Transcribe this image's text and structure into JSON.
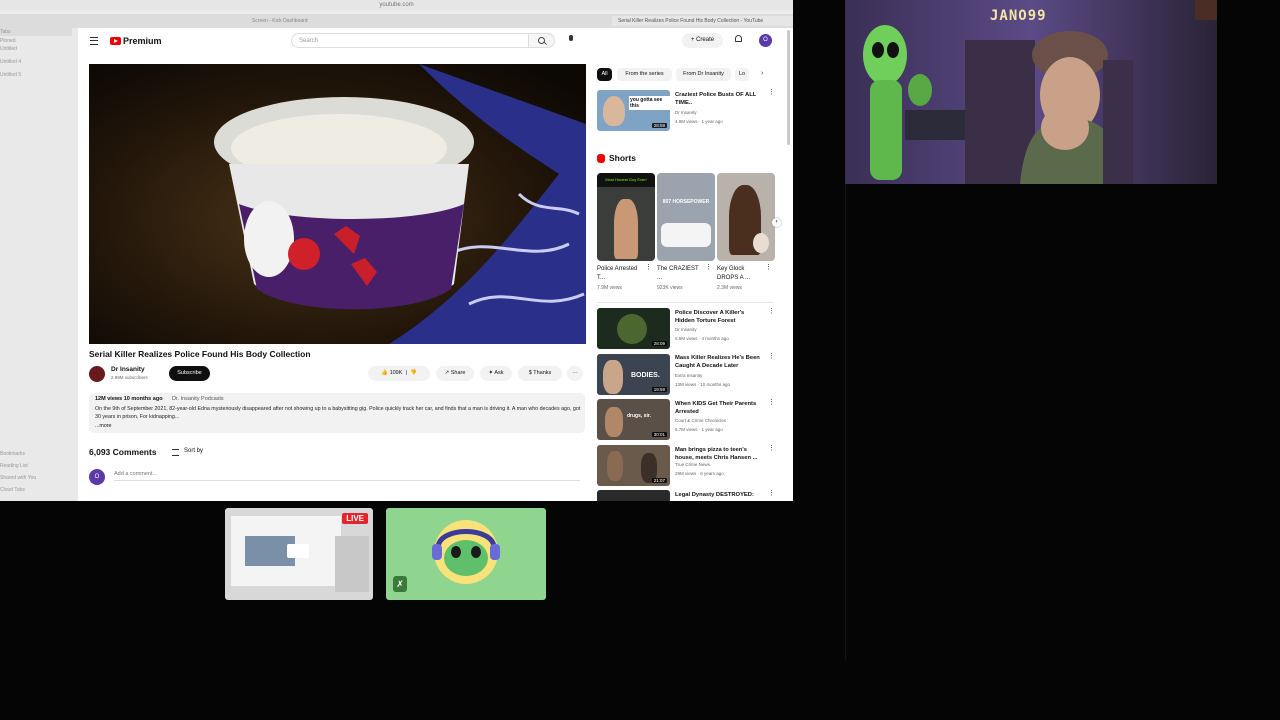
{
  "browser": {
    "url": "youtube.com",
    "tabs": [
      "Screen - Kick Dashboard",
      "Serial Killer Realizes Police Found His Body Collection - YouTube"
    ],
    "sidebar_items": [
      "Tabs",
      "Pinned",
      "Untitled",
      "Untitled 4",
      "Untitled 5",
      "Bookmarks",
      "Reading List",
      "Shared with You",
      "Cloud Tabs"
    ]
  },
  "header": {
    "logo": "Premium",
    "search_placeholder": "Search",
    "create_label": "Create",
    "avatar_letter": "O"
  },
  "video": {
    "title": "Serial Killer Realizes Police Found His Body Collection",
    "channel": "Dr Insanity",
    "subscribers": "2.99M subscribers",
    "subscribe_label": "Subscribe",
    "likes": "109K",
    "share_label": "Share",
    "ask_label": "Ask",
    "thanks_label": "Thanks",
    "description_meta": "12M views  10 months ago",
    "description_tag": "Dr. Insanity Podcasts",
    "description": "On the 9th of September 2021, 82-year-old Edna mysteriously disappeared after not showing up to a babysitting gig. Police quickly track her car, and finds that a man is driving it. A man who decades ago, got 30 years in prison, For kidnapping...",
    "more_label": "...more",
    "comments_count": "6,093 Comments",
    "sort_label": "Sort by",
    "add_comment_placeholder": "Add a comment..."
  },
  "chips": [
    "All",
    "From the series",
    "From Dr Insanity",
    "Lo"
  ],
  "recommended_top": {
    "title": "Craziest Police Busts OF ALL TIME..",
    "channel": "Dr Insanity",
    "meta": "4.9M views · 1 year ago",
    "duration": "28:59",
    "thumb_text": "you gotta see this"
  },
  "shorts": {
    "label": "Shorts",
    "items": [
      {
        "title": "Police Arrested T...",
        "views": "7.9M views",
        "thumb_text": "Most Honest Guy Ever!"
      },
      {
        "title": "The CRAZIEST ...",
        "views": "923K views",
        "thumb_text": "807 HORSEPOWER"
      },
      {
        "title": "Key Glock DROPS A ...",
        "views": "2.3M views",
        "thumb_text": ""
      }
    ]
  },
  "recommended": [
    {
      "title": "Police Discover A Killer's Hidden Torture Forest",
      "channel": "Dr Insanity",
      "meta": "5.5M views · 4 months ago",
      "duration": "28:09"
    },
    {
      "title": "Mass Killer Realizes He's Been Caught A Decade Later",
      "channel": "Extra Insanity",
      "meta": "13M views · 10 months ago",
      "duration": "19:59",
      "thumb_text": "BODIES."
    },
    {
      "title": "When KIDS Get Their Parents Arrested",
      "channel": "Court & Crime Chronicles",
      "meta": "5.7M views · 1 year ago",
      "duration": "30:01",
      "thumb_text": "drugs, sir."
    },
    {
      "title": "Man brings pizza to teen's house, meets Chris Hansen ...",
      "channel": "True Crime News",
      "meta": "29M views · 6 years ago",
      "duration": "21:07"
    },
    {
      "title": "Legal Dynasty DESTROYED:",
      "channel": "",
      "meta": "",
      "duration": ""
    }
  ],
  "stream": {
    "live_label": "LIVE",
    "webcam_text": "JANO99"
  }
}
